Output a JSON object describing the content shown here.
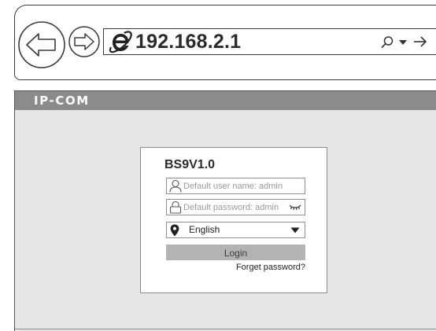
{
  "browser": {
    "address_url": "192.168.2.1",
    "icons": {
      "back": "back-arrow-icon",
      "forward": "forward-arrow-icon",
      "ie": "internet-explorer-icon",
      "search": "search-icon",
      "dropdown": "chevron-down-icon",
      "go": "go-arrow-icon"
    }
  },
  "page": {
    "brand": "IP-COM",
    "login": {
      "model": "BS9V1.0",
      "username_placeholder": "Default user name: admin",
      "password_placeholder": "Default password: admin",
      "language_selected": "English",
      "login_label": "Login",
      "forget_label": "Forget password?"
    }
  },
  "colors": {
    "topbar": "#8b8b8b",
    "page_background": "#e6e6e6",
    "login_button": "#b3b3b3"
  }
}
